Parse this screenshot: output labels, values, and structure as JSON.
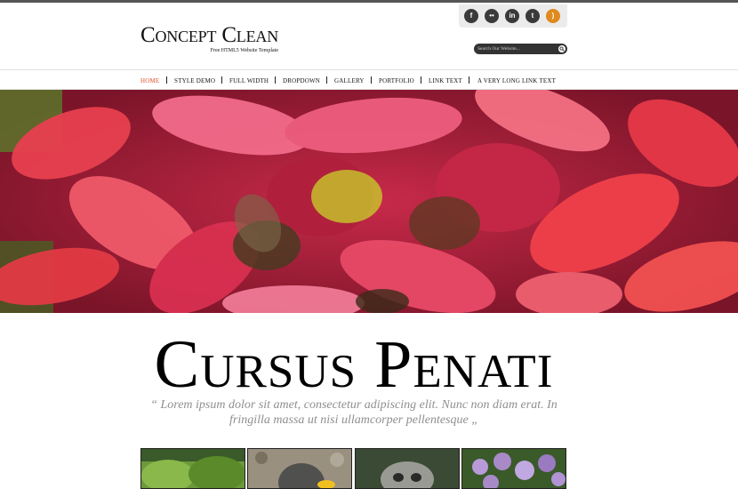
{
  "header": {
    "logo_title": "Concept Clean",
    "logo_subtitle": "Free HTML5 Website Template",
    "social": [
      {
        "name": "facebook",
        "glyph": "f"
      },
      {
        "name": "flickr",
        "glyph": "••"
      },
      {
        "name": "linkedin",
        "glyph": "in"
      },
      {
        "name": "twitter",
        "glyph": "t"
      },
      {
        "name": "rss",
        "glyph": ")"
      }
    ],
    "search_placeholder": "Search Our Website..."
  },
  "nav": {
    "items": [
      "Home",
      "Style Demo",
      "Full Width",
      "Dropdown",
      "Gallery",
      "Portfolio",
      "Link Text",
      "A Very Long Link Text"
    ],
    "active": "Home"
  },
  "colors": {
    "accent": "#e0522a",
    "nav_text": "#111111",
    "quote": "#8f8f8f"
  },
  "main": {
    "title": "Cursus Penati",
    "quote": "“ Lorem ipsum dolor sit amet, consectetur adipiscing elit. Nunc non diam erat. In fringilla massa ut nisi ullamcorper pellentesque „"
  },
  "icons": [
    "facebook-icon",
    "flickr-icon",
    "linkedin-icon",
    "twitter-icon",
    "rss-icon",
    "search-icon"
  ]
}
